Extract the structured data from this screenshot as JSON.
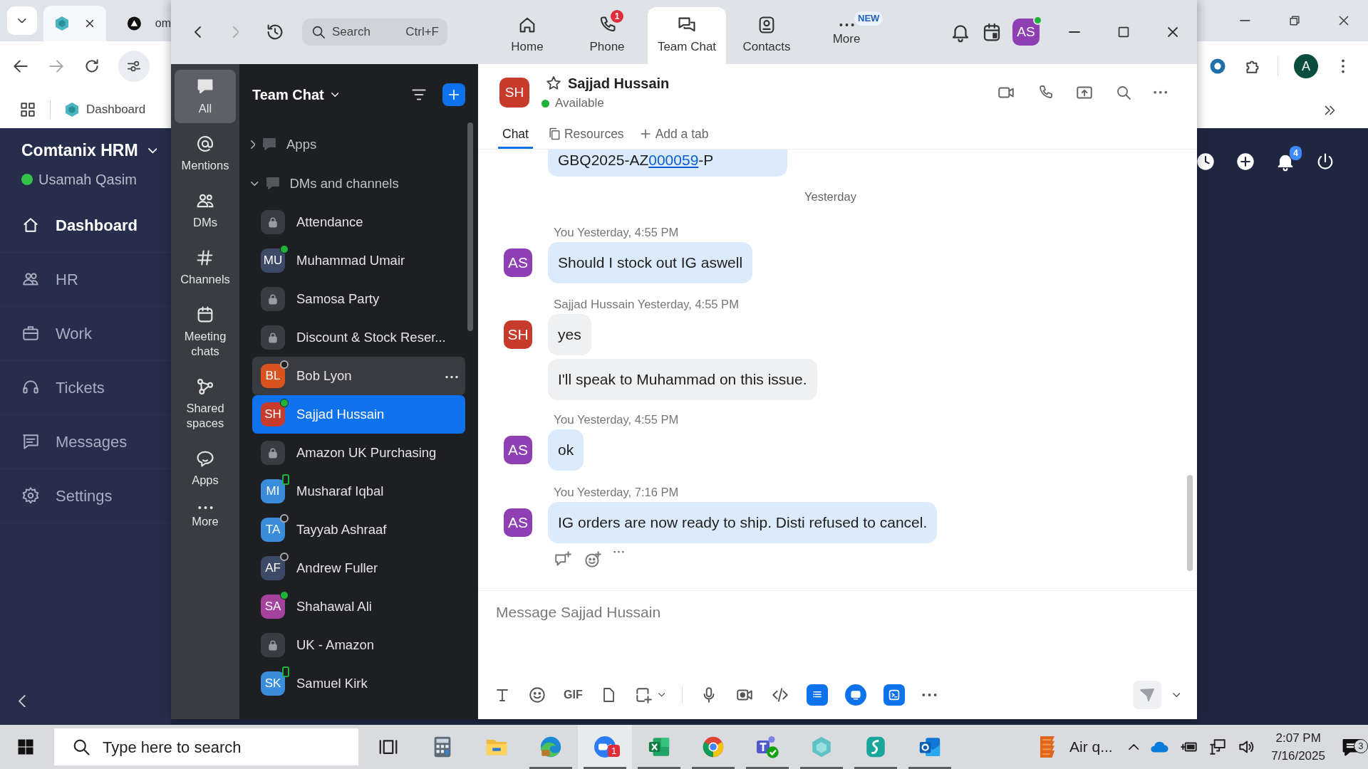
{
  "browser": {
    "tabs": [
      {
        "selected": true
      },
      {
        "title": "om",
        "selected": false
      }
    ],
    "bookmarks": [
      {
        "label": "Dashboard"
      }
    ],
    "profile": "A"
  },
  "hrm": {
    "org": "Comtanix HRM",
    "user": "Usamah Qasim",
    "alerts": "4",
    "nav": [
      {
        "label": "Dashboard",
        "selected": true
      },
      {
        "label": "HR",
        "selected": false
      },
      {
        "label": "Work",
        "selected": false
      },
      {
        "label": "Tickets",
        "selected": false
      },
      {
        "label": "Messages",
        "selected": false
      },
      {
        "label": "Settings",
        "selected": false
      }
    ]
  },
  "zoom": {
    "search": {
      "placeholder": "Search",
      "shortcut": "Ctrl+F"
    },
    "tabs": [
      {
        "label": "Home",
        "selected": false
      },
      {
        "label": "Phone",
        "selected": false,
        "badge": "1"
      },
      {
        "label": "Team Chat",
        "selected": true
      },
      {
        "label": "Contacts",
        "selected": false
      },
      {
        "label": "More",
        "selected": false,
        "badge": "NEW"
      }
    ],
    "user": "AS"
  },
  "rail": [
    {
      "label": "All",
      "selected": true
    },
    {
      "label": "Mentions",
      "selected": false
    },
    {
      "label": "DMs",
      "selected": false
    },
    {
      "label": "Channels",
      "selected": false
    },
    {
      "label": "Meeting chats",
      "selected": false
    },
    {
      "label": "Shared spaces",
      "selected": false
    },
    {
      "label": "Apps",
      "selected": false
    },
    {
      "label": "More",
      "selected": false
    }
  ],
  "list": {
    "title": "Team Chat",
    "sections": [
      {
        "label": "Apps",
        "expanded": false
      },
      {
        "label": "DMs and channels",
        "expanded": true
      }
    ],
    "items": [
      {
        "kind": "channel",
        "name": "Attendance",
        "selected": false,
        "hovered": false
      },
      {
        "kind": "person",
        "name": "Muhammad Umair",
        "initials": "MU",
        "color": "#3c4a68",
        "online": true,
        "on_mobile": false,
        "selected": false,
        "hovered": false
      },
      {
        "kind": "channel",
        "name": "Samosa Party",
        "selected": false,
        "hovered": false
      },
      {
        "kind": "channel",
        "name": "Discount & Stock Reser...",
        "selected": false,
        "hovered": false
      },
      {
        "kind": "person",
        "name": "Bob Lyon",
        "initials": "BL",
        "color": "#d9531e",
        "online": false,
        "on_mobile": false,
        "selected": false,
        "hovered": true
      },
      {
        "kind": "person",
        "name": "Sajjad Hussain",
        "initials": "SH",
        "color": "#c63b2b",
        "online": true,
        "on_mobile": false,
        "selected": true,
        "hovered": false
      },
      {
        "kind": "channel",
        "name": "Amazon UK Purchasing",
        "selected": false,
        "hovered": false
      },
      {
        "kind": "person",
        "name": "Musharaf Iqbal",
        "initials": "MI",
        "color": "#3a8ddb",
        "online": true,
        "on_mobile": true,
        "selected": false,
        "hovered": false
      },
      {
        "kind": "person",
        "name": "Tayyab Ashraaf",
        "initials": "TA",
        "color": "#3a8ddb",
        "online": false,
        "on_mobile": false,
        "selected": false,
        "hovered": false
      },
      {
        "kind": "person",
        "name": "Andrew Fuller",
        "initials": "AF",
        "color": "#3c4a68",
        "online": false,
        "on_mobile": false,
        "selected": false,
        "hovered": false
      },
      {
        "kind": "person",
        "name": "Shahawal Ali",
        "initials": "SA",
        "color": "#a5429e",
        "online": true,
        "on_mobile": false,
        "selected": false,
        "hovered": false
      },
      {
        "kind": "channel",
        "name": "UK - Amazon",
        "selected": false,
        "hovered": false
      },
      {
        "kind": "person",
        "name": "Samuel Kirk",
        "initials": "SK",
        "color": "#3a8ddb",
        "online": true,
        "on_mobile": true,
        "selected": false,
        "hovered": false
      }
    ]
  },
  "chat": {
    "name": "Sajjad Hussain",
    "initials": "SH",
    "color": "#c63b2b",
    "starred": false,
    "presence": "Available",
    "online": true,
    "tabs": [
      {
        "label": "Chat",
        "selected": true
      },
      {
        "label": "Resources",
        "selected": false
      },
      {
        "label": "Add a tab",
        "selected": false
      }
    ],
    "messages": [
      {
        "kind": "partial",
        "mine": true,
        "parts": [
          {
            "text": "GBQ2025-AZ"
          },
          {
            "text": "000059",
            "link": true
          },
          {
            "text": "-P"
          }
        ]
      },
      {
        "kind": "divider",
        "text": "Yesterday"
      },
      {
        "kind": "group",
        "sender": "You",
        "time": "Yesterday, 4:55 PM",
        "initials": "AS",
        "color": "#8e3fb3",
        "mine": true,
        "bubbles": [
          "Should I stock out IG aswell"
        ]
      },
      {
        "kind": "group",
        "sender": "Sajjad Hussain",
        "time": "Yesterday, 4:55 PM",
        "initials": "SH",
        "color": "#c63b2b",
        "mine": false,
        "bubbles": [
          "yes",
          "I'll speak to Muhammad on this issue."
        ]
      },
      {
        "kind": "group",
        "sender": "You",
        "time": "Yesterday, 4:55 PM",
        "initials": "AS",
        "color": "#8e3fb3",
        "mine": true,
        "bubbles": [
          "ok"
        ]
      },
      {
        "kind": "group",
        "sender": "You",
        "time": "Yesterday, 7:16 PM",
        "initials": "AS",
        "color": "#8e3fb3",
        "mine": true,
        "bubbles": [
          "IG orders are now ready to ship. Disti refused to cancel."
        ],
        "show_actions": true
      }
    ],
    "composer": {
      "placeholder": "Message Sajjad Hussain",
      "gif_label": "GIF"
    }
  },
  "taskbar": {
    "search_placeholder": "Type here to search",
    "apps": [
      {
        "kind": "taskview",
        "running": false,
        "active": false
      },
      {
        "kind": "calculator",
        "running": false,
        "active": false
      },
      {
        "kind": "folder",
        "running": false,
        "active": false
      },
      {
        "kind": "edge",
        "running": true,
        "active": false
      },
      {
        "kind": "zoom",
        "running": true,
        "active": true,
        "badge": "1"
      },
      {
        "kind": "excel",
        "running": true,
        "active": false
      },
      {
        "kind": "chrome",
        "running": true,
        "active": false
      },
      {
        "kind": "teams",
        "running": true,
        "active": false
      },
      {
        "kind": "crystal",
        "running": true,
        "active": false
      },
      {
        "kind": "surf",
        "running": true,
        "active": false
      },
      {
        "kind": "outlook",
        "running": true,
        "active": false
      }
    ],
    "weather": "Air q...",
    "time": "2:07 PM",
    "date": "7/16/2025",
    "notifications": "3"
  }
}
